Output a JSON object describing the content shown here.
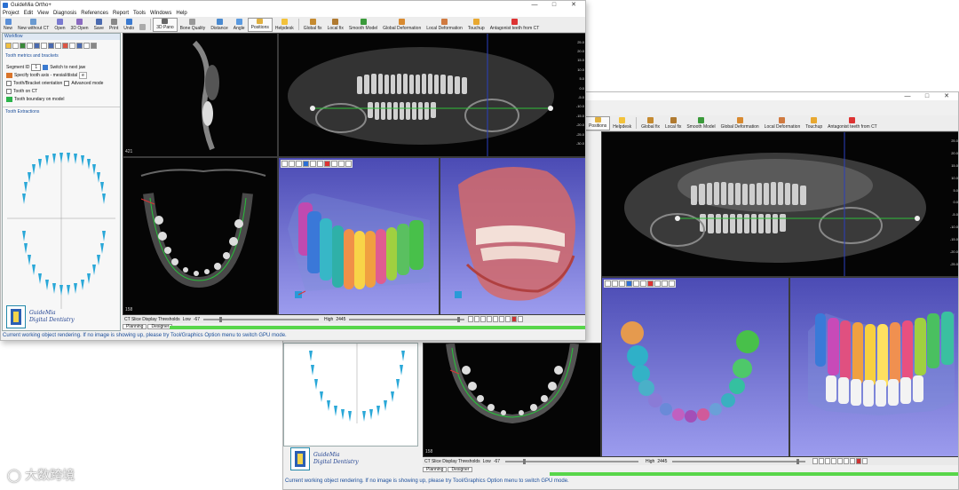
{
  "front_window": {
    "title": "GuideMia Ortho+",
    "window_controls": [
      "—",
      "□",
      "✕"
    ],
    "menu": [
      "Project",
      "Edit",
      "View",
      "Diagnosis",
      "References",
      "Report",
      "Tools",
      "Windows",
      "Help"
    ],
    "toolbar": [
      {
        "label": "New",
        "icon": "new-icon"
      },
      {
        "label": "New without CT",
        "icon": "new-without-ct-icon"
      },
      {
        "label": "Open",
        "icon": "open-icon"
      },
      {
        "label": "3D Open",
        "icon": "3d-open-icon"
      },
      {
        "label": "Save",
        "icon": "save-icon"
      },
      {
        "label": "Print",
        "icon": "print-icon"
      },
      {
        "label": "Undo",
        "icon": "undo-icon"
      },
      {
        "label": "",
        "icon": "redo-icon"
      },
      {
        "label": "3D Pano",
        "icon": "3d-pano-icon"
      },
      {
        "label": "Bone Quality",
        "icon": "bone-quality-icon"
      },
      {
        "label": "Distance",
        "icon": "distance-icon"
      },
      {
        "label": "Angle",
        "icon": "angle-icon"
      },
      {
        "label": "Positions",
        "icon": "positions-icon"
      },
      {
        "label": "Helpdesk",
        "icon": "helpdesk-icon"
      },
      {
        "label": "Global fix",
        "icon": "global-fix-icon"
      },
      {
        "label": "Local fix",
        "icon": "local-fix-icon"
      },
      {
        "label": "Smooth Model",
        "icon": "smooth-model-icon"
      },
      {
        "label": "Global Deformation",
        "icon": "global-deformation-icon"
      },
      {
        "label": "Local Deformation",
        "icon": "local-deformation-icon"
      },
      {
        "label": "Touchup",
        "icon": "touchup-icon"
      },
      {
        "label": "Antagonist teeth from CT",
        "icon": "antagonist-icon"
      }
    ],
    "workflow": {
      "header": "Workflow",
      "section1": "Tooth metrics and brackets",
      "segment_label": "Segment ID",
      "segment_value": "1",
      "switch_jaw": "Switch to next jaw",
      "items": [
        {
          "label": "Specify tooth axis - mesial/distal"
        },
        {
          "label": "Tooth/Bracket orientation"
        },
        {
          "label": "Tooth on CT"
        },
        {
          "label": "Tooth boundary on model"
        }
      ],
      "advanced_mode": "Advanced mode",
      "section2": "Tooth Extractions"
    },
    "logo_line1": "GuideMia",
    "logo_line2": "Digital Dentistry",
    "view_labels": {
      "axial_top": "421",
      "axial_bottom": "158"
    },
    "ruler_ticks": [
      "25.0",
      "20.0",
      "15.0",
      "10.0",
      "5.0",
      "0.0",
      "-5.0",
      "-10.0",
      "-15.0",
      "-20.0",
      "-25.0",
      "-30.0"
    ],
    "threshold": {
      "prefix": "CT Slice Display Thresholds",
      "low_label": "Low",
      "low_value": "-67",
      "high_label": "High",
      "high_value": "2445"
    },
    "tabs": [
      "Planning",
      "Designer"
    ],
    "status": "Current working object rendering. If no image is showing up, please try Tool/Graphics Option menu to switch GPU mode."
  },
  "back_window": {
    "window_controls": [
      "—",
      "□",
      "✕"
    ],
    "toolbar": [
      {
        "label": "Positions",
        "icon": "positions-icon"
      },
      {
        "label": "Helpdesk",
        "icon": "helpdesk-icon"
      },
      {
        "label": "Global fix",
        "icon": "global-fix-icon"
      },
      {
        "label": "Local fix",
        "icon": "local-fix-icon"
      },
      {
        "label": "Smooth Model",
        "icon": "smooth-model-icon"
      },
      {
        "label": "Global Deformation",
        "icon": "global-deformation-icon"
      },
      {
        "label": "Local Deformation",
        "icon": "local-deformation-icon"
      },
      {
        "label": "Touchup",
        "icon": "touchup-icon"
      },
      {
        "label": "Antagonist teeth from CT",
        "icon": "antagonist-icon"
      }
    ],
    "logo_line1": "GuideMia",
    "logo_line2": "Digital Dentistry",
    "view_label": "158",
    "ruler_ticks": [
      "25.0",
      "20.0",
      "15.0",
      "10.0",
      "5.0",
      "0.0",
      "-5.0",
      "-10.0",
      "-15.0",
      "-20.0",
      "-25.0"
    ],
    "threshold": {
      "prefix": "CT Slice Display Thresholds",
      "low_label": "Low",
      "low_value": "-67",
      "high_label": "High",
      "high_value": "2445"
    },
    "tabs": [
      "Planning",
      "Designer"
    ],
    "status": "Current working object rendering. If no image is showing up, please try Tool/Graphics Option menu to switch GPU mode."
  },
  "watermark": "大数跨境",
  "colors": {
    "accent": "#1a4d9a",
    "tooth_blue": "#2aa8d8",
    "green_bar": "#58d64a",
    "viewport_bg": "#050505"
  }
}
